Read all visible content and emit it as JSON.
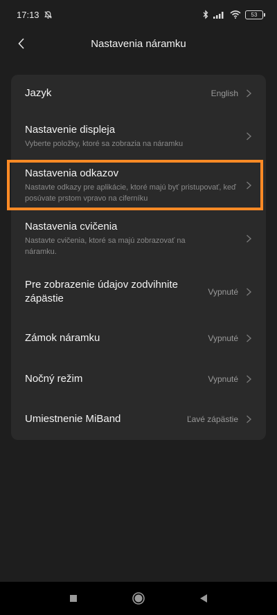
{
  "status_bar": {
    "time": "17:13",
    "battery_level": "53",
    "icons": [
      "bell-off-icon",
      "bluetooth-icon",
      "signal-icon",
      "wifi-icon",
      "battery-icon"
    ]
  },
  "header": {
    "title": "Nastavenia náramku",
    "back_icon": "chevron-left-icon"
  },
  "settings": [
    {
      "id": "language",
      "title": "Jazyk",
      "subtitle": "",
      "value": "English"
    },
    {
      "id": "display",
      "title": "Nastavenie displeja",
      "subtitle": "Vyberte položky, ktoré sa zobrazia na náramku",
      "value": ""
    },
    {
      "id": "shortcuts",
      "title": "Nastavenia odkazov",
      "subtitle": "Nastavte odkazy pre aplikácie, ktoré majú byť pristupovať, keď posúvate prstom vpravo na ciferníku",
      "value": "",
      "highlighted": true
    },
    {
      "id": "workout",
      "title": "Nastavenia cvičenia",
      "subtitle": "Nastavte cvičenia, ktoré sa majú zobrazovať na náramku.",
      "value": ""
    },
    {
      "id": "raise-wrist",
      "title": "Pre zobrazenie údajov zodvihnite zápästie",
      "subtitle": "",
      "value": "Vypnuté"
    },
    {
      "id": "lock",
      "title": "Zámok náramku",
      "subtitle": "",
      "value": "Vypnuté"
    },
    {
      "id": "night-mode",
      "title": "Nočný režim",
      "subtitle": "",
      "value": "Vypnuté"
    },
    {
      "id": "placement",
      "title": "Umiestnenie MiBand",
      "subtitle": "",
      "value": "Ľavé zápästie"
    }
  ],
  "colors": {
    "background": "#1e1e1e",
    "card": "#2a2a2a",
    "highlight": "#ff8a25"
  },
  "nav_bar": [
    "square-icon",
    "circle-icon",
    "triangle-back-icon"
  ]
}
